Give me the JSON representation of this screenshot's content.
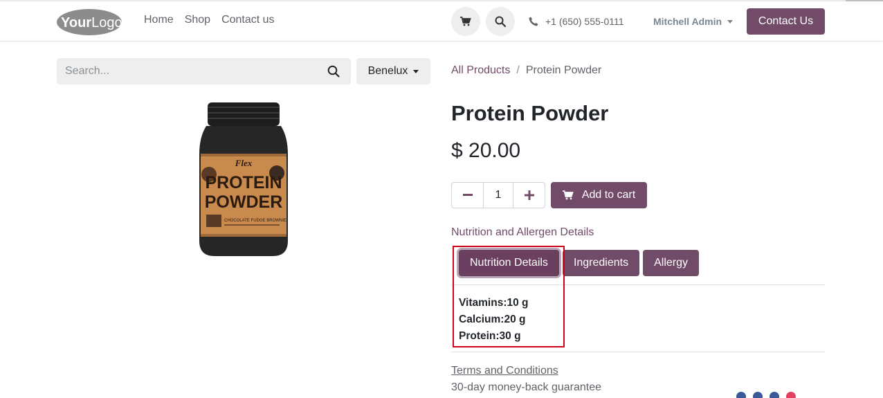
{
  "header": {
    "logo_text": "YourLogo",
    "nav": [
      "Home",
      "Shop",
      "Contact us"
    ],
    "cart_icon": "cart-icon",
    "search_icon": "search-icon",
    "phone": "+1 (650) 555-0111",
    "user": "Mitchell Admin",
    "contact_button": "Contact Us"
  },
  "search": {
    "placeholder": "Search...",
    "region": "Benelux"
  },
  "product": {
    "image_label": {
      "brand": "Flex",
      "line1": "PROTEIN",
      "line2": "POWDER",
      "flavor": "CHOCOLATE FUDGE BROWNIE"
    },
    "breadcrumb": {
      "root": "All Products",
      "separator": "/",
      "current": "Protein Powder"
    },
    "title": "Protein Powder",
    "price": "$ 20.00",
    "quantity": "1",
    "add_to_cart": "Add to cart",
    "nutrition_heading": "Nutrition and Allergen Details",
    "tabs": [
      "Nutrition Details",
      "Ingredients",
      "Allergy"
    ],
    "details": [
      "Vitamins:10 g",
      "Calcium:20 g",
      "Protein:30 g"
    ],
    "terms": "Terms and Conditions",
    "guarantee": "30-day money-back guarantee"
  },
  "colors": {
    "brand": "#714b67",
    "highlight": "#d0021b",
    "social_blue": "#3b5998",
    "social_red": "#e4405f"
  }
}
